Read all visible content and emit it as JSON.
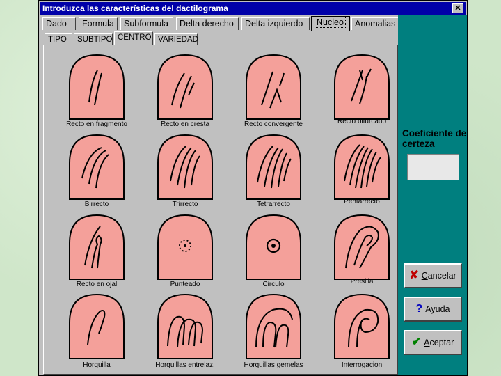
{
  "window": {
    "title": "Introduzca las características del dactilograma",
    "close_label": "✕"
  },
  "tabs": [
    {
      "label": "Dado"
    },
    {
      "label": "Formula"
    },
    {
      "label": "Subformula"
    },
    {
      "label": "Delta derecho"
    },
    {
      "label": "Delta izquierdo"
    },
    {
      "label": "Nucleo",
      "active": true
    },
    {
      "label": "Anomalias"
    }
  ],
  "subtabs": [
    {
      "label": "TIPO"
    },
    {
      "label": "SUBTIPO"
    },
    {
      "label": "CENTRO",
      "active": true
    },
    {
      "label": "VARIEDAD"
    }
  ],
  "patterns": [
    {
      "label": "Recto en fragmento",
      "icon": "recto-fragmento-icon"
    },
    {
      "label": "Recto en cresta",
      "icon": "recto-cresta-icon"
    },
    {
      "label": "Recto convergente",
      "icon": "recto-convergente-icon"
    },
    {
      "label": "Recto bifurcado",
      "icon": "recto-bifurcado-icon"
    },
    {
      "label": "Birrecto",
      "icon": "birrecto-icon"
    },
    {
      "label": "Trirrecto",
      "icon": "trirrecto-icon"
    },
    {
      "label": "Tetrarrecto",
      "icon": "tetrarrecto-icon"
    },
    {
      "label": "Pentarrecto",
      "icon": "pentarrecto-icon"
    },
    {
      "label": "Recto en ojal",
      "icon": "recto-ojal-icon"
    },
    {
      "label": "Punteado",
      "icon": "punteado-icon"
    },
    {
      "label": "Circulo",
      "icon": "circulo-icon"
    },
    {
      "label": "Presilla",
      "icon": "presilla-icon"
    },
    {
      "label": "Horquilla",
      "icon": "horquilla-icon"
    },
    {
      "label": "Horquillas entrelaz.",
      "icon": "horquillas-entrelazadas-icon"
    },
    {
      "label": "Horquillas gemelas",
      "icon": "horquillas-gemelas-icon"
    },
    {
      "label": "Interrogacion",
      "icon": "interrogacion-icon"
    }
  ],
  "coeficiente": {
    "title": "Coeficiente de certeza",
    "value": ""
  },
  "buttons": {
    "cancelar": {
      "label": "Cancelar",
      "icon": "x-icon"
    },
    "ayuda": {
      "label": "Ayuda",
      "icon": "question-icon"
    },
    "aceptar": {
      "label": "Aceptar",
      "icon": "check-icon"
    }
  },
  "colors": {
    "finger_fill": "#f4a09a",
    "titlebar": "#0000a8",
    "side_panel": "#007f7f"
  }
}
